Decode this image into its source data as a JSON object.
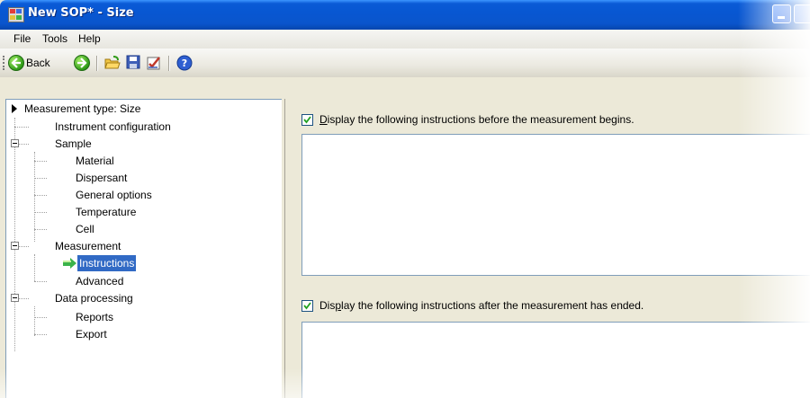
{
  "window": {
    "title": "New SOP* - Size",
    "app_icon": "app-window-icon",
    "title_color": "#0a5ad6"
  },
  "menu": {
    "items": [
      "File",
      "Tools",
      "Help"
    ]
  },
  "toolbar": {
    "back_label": "Back",
    "icons": [
      "back-icon",
      "forward-icon",
      "open-icon",
      "save-icon",
      "edit-icon",
      "help-icon"
    ]
  },
  "tree": {
    "items": [
      {
        "label": "Measurement type: Size"
      },
      {
        "label": "Instrument configuration"
      },
      {
        "label": "Sample"
      },
      {
        "label": "Material"
      },
      {
        "label": "Dispersant"
      },
      {
        "label": "General options"
      },
      {
        "label": "Temperature"
      },
      {
        "label": "Cell"
      },
      {
        "label": "Measurement"
      },
      {
        "label": "Instructions",
        "selected": true
      },
      {
        "label": "Advanced"
      },
      {
        "label": "Data processing"
      },
      {
        "label": "Reports"
      },
      {
        "label": "Export"
      }
    ]
  },
  "content": {
    "before": {
      "checked": true,
      "label_prefix": "",
      "label_mnemonic": "D",
      "label_rest": "isplay the following instructions before the measurement begins.",
      "value": ""
    },
    "after": {
      "checked": true,
      "label_prefix": "Dis",
      "label_mnemonic": "p",
      "label_rest": "lay the following instructions after the measurement has ended.",
      "value": ""
    }
  },
  "colors": {
    "selection": "#316ac5",
    "panel_bg": "#ece9d8",
    "check_green": "#21a121"
  }
}
